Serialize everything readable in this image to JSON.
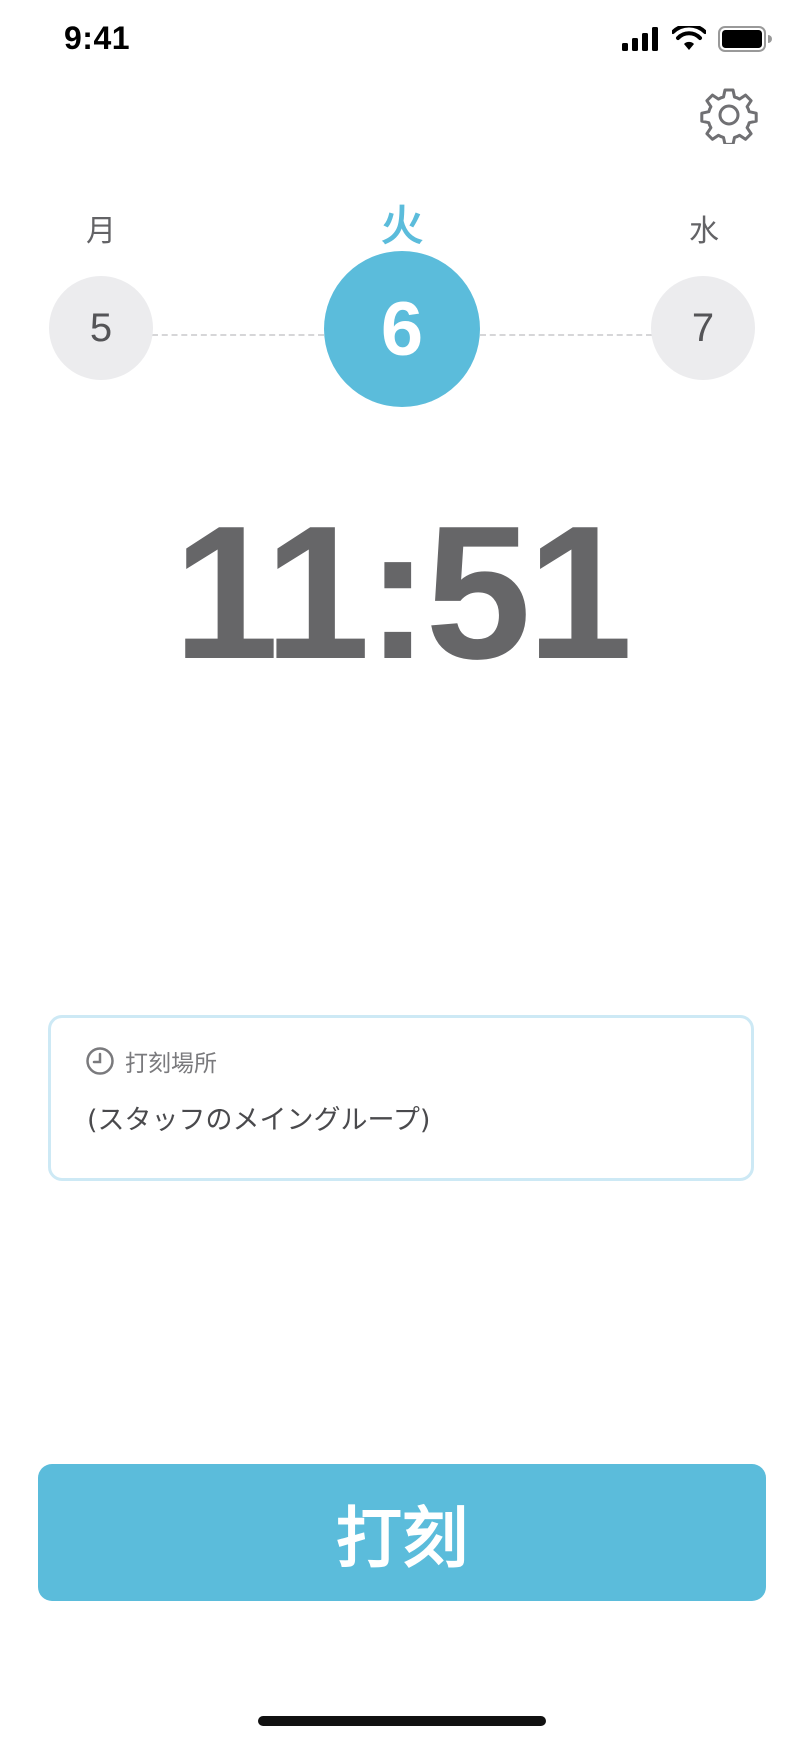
{
  "status_bar": {
    "time": "9:41"
  },
  "days": [
    {
      "weekday": "月",
      "date": "5",
      "selected": false
    },
    {
      "weekday": "火",
      "date": "6",
      "selected": true
    },
    {
      "weekday": "水",
      "date": "7",
      "selected": false
    }
  ],
  "clock": {
    "time": "11:51"
  },
  "location": {
    "label": "打刻場所",
    "value": "(スタッフのメイングループ)",
    "icon": "clock-icon"
  },
  "punch_button": {
    "label": "打刻"
  },
  "colors": {
    "accent": "#5BBCDB",
    "inactive_circle": "#ECECEE",
    "card_border": "#CDE9F5",
    "clock_text": "#666668"
  },
  "icons": [
    "cellular-signal-icon",
    "wifi-icon",
    "battery-icon",
    "gear-icon",
    "clock-icon"
  ]
}
